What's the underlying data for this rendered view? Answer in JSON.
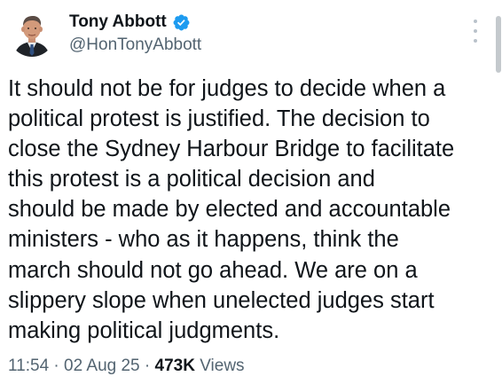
{
  "author": {
    "name": "Tony Abbott",
    "handle": "@HonTonyAbbott",
    "verified": true,
    "verified_color": "#1d9bf0"
  },
  "tweet": {
    "lines": [
      "It should not be for judges to decide when a",
      "political protest is justified. The decision to",
      "close the Sydney Harbour Bridge to facilitate",
      "this protest is a political decision and",
      "should be made by elected and accountable",
      "ministers - who as it happens, think the",
      "march should not go ahead. We are on a",
      "slippery slope when unelected judges start",
      "making political judgments."
    ]
  },
  "meta": {
    "time": "11:54",
    "separator": "·",
    "date": "02 Aug 25",
    "views_count": "473K",
    "views_label": "Views"
  },
  "icons": {
    "more": "more-vertical-icon",
    "verified": "verified-badge-icon"
  },
  "colors": {
    "text": "#0f1419",
    "secondary": "#536471",
    "accent": "#1d9bf0"
  }
}
